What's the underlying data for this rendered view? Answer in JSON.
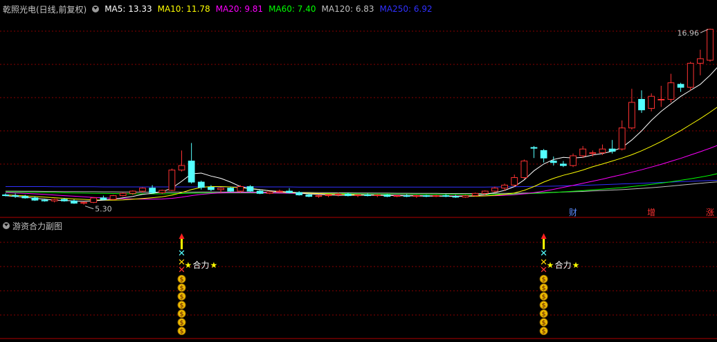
{
  "header": {
    "title": "乾照光电(日线,前复权)",
    "ma": [
      {
        "label": "MA5: 13.33",
        "color": "#ffffff"
      },
      {
        "label": "MA10: 11.78",
        "color": "#ffff00"
      },
      {
        "label": "MA20: 9.81",
        "color": "#ff00ff"
      },
      {
        "label": "MA60: 7.40",
        "color": "#00ff00"
      },
      {
        "label": "MA120: 6.83",
        "color": "#c0c0c0"
      },
      {
        "label": "MA250: 6.92",
        "color": "#3030ff"
      }
    ]
  },
  "sub_panel": {
    "title": "游资合力副图",
    "signal_text": "合力"
  },
  "colors": {
    "up": "#ff3232",
    "down": "#54ffff",
    "ma5": "#ffffff",
    "ma10": "#ffff00",
    "ma20": "#ff00ff",
    "ma60": "#00ff00",
    "ma120": "#c0c0c0",
    "ma250": "#3030ff",
    "grid": "#8b0000"
  },
  "chart_data": {
    "type": "candlestick",
    "ylim": [
      4.5,
      17.8
    ],
    "annotations": {
      "high_label": "16.96",
      "low_label": "5.30"
    },
    "candles": [
      {
        "o": 5.95,
        "h": 6.05,
        "l": 5.85,
        "c": 5.9
      },
      {
        "o": 5.9,
        "h": 6.05,
        "l": 5.75,
        "c": 5.85
      },
      {
        "o": 5.85,
        "h": 5.95,
        "l": 5.7,
        "c": 5.75
      },
      {
        "o": 5.75,
        "h": 5.85,
        "l": 5.55,
        "c": 5.6
      },
      {
        "o": 5.6,
        "h": 5.7,
        "l": 5.5,
        "c": 5.55
      },
      {
        "o": 5.55,
        "h": 5.7,
        "l": 5.45,
        "c": 5.65
      },
      {
        "o": 5.65,
        "h": 5.75,
        "l": 5.5,
        "c": 5.55
      },
      {
        "o": 5.55,
        "h": 5.65,
        "l": 5.35,
        "c": 5.4
      },
      {
        "o": 5.4,
        "h": 5.5,
        "l": 5.3,
        "c": 5.45
      },
      {
        "o": 5.45,
        "h": 5.8,
        "l": 5.4,
        "c": 5.75
      },
      {
        "o": 5.75,
        "h": 5.9,
        "l": 5.6,
        "c": 5.65
      },
      {
        "o": 5.65,
        "h": 5.95,
        "l": 5.6,
        "c": 5.9
      },
      {
        "o": 5.9,
        "h": 6.1,
        "l": 5.85,
        "c": 6.05
      },
      {
        "o": 6.05,
        "h": 6.25,
        "l": 5.95,
        "c": 6.2
      },
      {
        "o": 6.2,
        "h": 6.45,
        "l": 6.1,
        "c": 6.4
      },
      {
        "o": 6.4,
        "h": 6.6,
        "l": 6.05,
        "c": 6.1
      },
      {
        "o": 6.1,
        "h": 6.3,
        "l": 6.0,
        "c": 6.25
      },
      {
        "o": 6.25,
        "h": 7.7,
        "l": 6.2,
        "c": 7.6
      },
      {
        "o": 7.6,
        "h": 8.9,
        "l": 7.5,
        "c": 7.9
      },
      {
        "o": 8.2,
        "h": 9.4,
        "l": 6.7,
        "c": 6.8
      },
      {
        "o": 6.8,
        "h": 6.9,
        "l": 6.3,
        "c": 6.45
      },
      {
        "o": 6.45,
        "h": 6.6,
        "l": 6.2,
        "c": 6.3
      },
      {
        "o": 6.3,
        "h": 6.45,
        "l": 6.1,
        "c": 6.4
      },
      {
        "o": 6.4,
        "h": 6.5,
        "l": 6.15,
        "c": 6.2
      },
      {
        "o": 6.2,
        "h": 6.6,
        "l": 6.1,
        "c": 6.5
      },
      {
        "o": 6.5,
        "h": 6.6,
        "l": 6.15,
        "c": 6.2
      },
      {
        "o": 6.2,
        "h": 6.3,
        "l": 6.0,
        "c": 6.05
      },
      {
        "o": 6.05,
        "h": 6.2,
        "l": 6.0,
        "c": 6.15
      },
      {
        "o": 6.15,
        "h": 6.3,
        "l": 6.1,
        "c": 6.2
      },
      {
        "o": 6.2,
        "h": 6.4,
        "l": 6.05,
        "c": 6.1
      },
      {
        "o": 6.1,
        "h": 6.2,
        "l": 5.9,
        "c": 5.95
      },
      {
        "o": 5.95,
        "h": 6.05,
        "l": 5.8,
        "c": 5.85
      },
      {
        "o": 5.85,
        "h": 5.95,
        "l": 5.75,
        "c": 5.9
      },
      {
        "o": 5.9,
        "h": 6.0,
        "l": 5.8,
        "c": 5.95
      },
      {
        "o": 5.95,
        "h": 6.1,
        "l": 5.85,
        "c": 6.0
      },
      {
        "o": 6.0,
        "h": 6.1,
        "l": 5.85,
        "c": 5.9
      },
      {
        "o": 5.9,
        "h": 6.0,
        "l": 5.8,
        "c": 5.95
      },
      {
        "o": 5.95,
        "h": 6.05,
        "l": 5.85,
        "c": 5.9
      },
      {
        "o": 5.9,
        "h": 6.0,
        "l": 5.8,
        "c": 5.95
      },
      {
        "o": 5.95,
        "h": 6.0,
        "l": 5.8,
        "c": 5.85
      },
      {
        "o": 5.85,
        "h": 5.95,
        "l": 5.8,
        "c": 5.9
      },
      {
        "o": 5.9,
        "h": 6.0,
        "l": 5.8,
        "c": 5.85
      },
      {
        "o": 5.85,
        "h": 5.95,
        "l": 5.75,
        "c": 5.9
      },
      {
        "o": 5.9,
        "h": 5.95,
        "l": 5.8,
        "c": 5.85
      },
      {
        "o": 5.85,
        "h": 5.95,
        "l": 5.8,
        "c": 5.9
      },
      {
        "o": 5.9,
        "h": 6.0,
        "l": 5.8,
        "c": 5.85
      },
      {
        "o": 5.85,
        "h": 5.95,
        "l": 5.75,
        "c": 5.8
      },
      {
        "o": 5.8,
        "h": 5.95,
        "l": 5.75,
        "c": 5.9
      },
      {
        "o": 5.9,
        "h": 6.1,
        "l": 5.85,
        "c": 6.05
      },
      {
        "o": 6.05,
        "h": 6.25,
        "l": 5.95,
        "c": 6.2
      },
      {
        "o": 6.2,
        "h": 6.5,
        "l": 6.1,
        "c": 6.4
      },
      {
        "o": 6.4,
        "h": 6.7,
        "l": 6.2,
        "c": 6.6
      },
      {
        "o": 6.6,
        "h": 7.3,
        "l": 6.5,
        "c": 7.1
      },
      {
        "o": 7.1,
        "h": 8.3,
        "l": 7.0,
        "c": 8.2
      },
      {
        "o": 9.1,
        "h": 9.2,
        "l": 8.4,
        "c": 9.05
      },
      {
        "o": 8.9,
        "h": 9.0,
        "l": 8.1,
        "c": 8.4
      },
      {
        "o": 8.2,
        "h": 8.5,
        "l": 7.9,
        "c": 8.1
      },
      {
        "o": 8.0,
        "h": 8.2,
        "l": 7.8,
        "c": 7.9
      },
      {
        "o": 7.9,
        "h": 8.7,
        "l": 7.8,
        "c": 8.55
      },
      {
        "o": 8.55,
        "h": 9.2,
        "l": 8.4,
        "c": 9.0
      },
      {
        "o": 8.7,
        "h": 8.9,
        "l": 8.5,
        "c": 8.75
      },
      {
        "o": 8.75,
        "h": 9.3,
        "l": 8.6,
        "c": 9.0
      },
      {
        "o": 9.0,
        "h": 9.6,
        "l": 8.7,
        "c": 8.85
      },
      {
        "o": 9.0,
        "h": 10.9,
        "l": 8.9,
        "c": 10.4
      },
      {
        "o": 10.4,
        "h": 13.0,
        "l": 10.3,
        "c": 12.1
      },
      {
        "o": 12.3,
        "h": 12.9,
        "l": 11.4,
        "c": 11.6
      },
      {
        "o": 11.7,
        "h": 12.7,
        "l": 11.5,
        "c": 12.5
      },
      {
        "o": 12.3,
        "h": 13.2,
        "l": 11.8,
        "c": 12.3
      },
      {
        "o": 12.3,
        "h": 14.0,
        "l": 12.1,
        "c": 13.4
      },
      {
        "o": 13.3,
        "h": 13.4,
        "l": 12.8,
        "c": 13.1
      },
      {
        "o": 13.1,
        "h": 14.8,
        "l": 12.9,
        "c": 14.7
      },
      {
        "o": 14.7,
        "h": 15.6,
        "l": 13.9,
        "c": 15.0
      },
      {
        "o": 14.9,
        "h": 17.0,
        "l": 14.8,
        "c": 16.96
      }
    ],
    "ma5": [
      5.9,
      5.85,
      5.8,
      5.72,
      5.66,
      5.6,
      5.58,
      5.55,
      5.52,
      5.56,
      5.6,
      5.66,
      5.75,
      5.85,
      5.98,
      6.05,
      6.15,
      6.4,
      6.85,
      7.35,
      7.4,
      7.2,
      7.05,
      6.8,
      6.5,
      6.35,
      6.3,
      6.22,
      6.18,
      6.14,
      6.08,
      6.02,
      5.98,
      5.95,
      5.92,
      5.92,
      5.93,
      5.94,
      5.93,
      5.92,
      5.9,
      5.89,
      5.88,
      5.87,
      5.87,
      5.86,
      5.85,
      5.86,
      5.9,
      5.98,
      6.1,
      6.25,
      6.5,
      6.95,
      7.55,
      8.0,
      8.3,
      8.45,
      8.4,
      8.45,
      8.6,
      8.7,
      8.85,
      9.1,
      9.6,
      10.2,
      10.9,
      11.5,
      12.0,
      12.5,
      12.9,
      13.3,
      13.9,
      14.6
    ],
    "ma10": [
      5.95,
      5.92,
      5.88,
      5.84,
      5.8,
      5.76,
      5.72,
      5.68,
      5.65,
      5.62,
      5.6,
      5.6,
      5.62,
      5.66,
      5.71,
      5.76,
      5.82,
      5.93,
      6.1,
      6.3,
      6.45,
      6.5,
      6.5,
      6.48,
      6.42,
      6.38,
      6.3,
      6.22,
      6.15,
      6.1,
      6.08,
      6.06,
      6.04,
      6.02,
      6.0,
      5.98,
      5.96,
      5.94,
      5.92,
      5.91,
      5.9,
      5.9,
      5.89,
      5.88,
      5.88,
      5.87,
      5.86,
      5.86,
      5.86,
      5.88,
      5.92,
      5.98,
      6.08,
      6.25,
      6.5,
      6.8,
      7.05,
      7.25,
      7.42,
      7.6,
      7.82,
      8.0,
      8.2,
      8.4,
      8.62,
      8.88,
      9.18,
      9.5,
      9.85,
      10.22,
      10.62,
      11.02,
      11.45,
      11.9
    ],
    "ma20": [
      6.1,
      6.08,
      6.05,
      6.02,
      5.98,
      5.94,
      5.9,
      5.86,
      5.82,
      5.78,
      5.75,
      5.72,
      5.7,
      5.68,
      5.67,
      5.67,
      5.68,
      5.72,
      5.8,
      5.9,
      5.98,
      6.04,
      6.08,
      6.1,
      6.1,
      6.1,
      6.1,
      6.08,
      6.07,
      6.06,
      6.05,
      6.04,
      6.03,
      6.01,
      6.0,
      5.99,
      5.97,
      5.96,
      5.95,
      5.94,
      5.93,
      5.92,
      5.91,
      5.9,
      5.89,
      5.88,
      5.88,
      5.88,
      5.88,
      5.89,
      5.9,
      5.92,
      5.96,
      6.02,
      6.1,
      6.2,
      6.32,
      6.45,
      6.58,
      6.72,
      6.86,
      7.0,
      7.15,
      7.3,
      7.46,
      7.62,
      7.8,
      7.98,
      8.18,
      8.38,
      8.6,
      8.82,
      9.05,
      9.3
    ],
    "ma60": [
      6.15,
      6.14,
      6.13,
      6.12,
      6.11,
      6.1,
      6.09,
      6.08,
      6.07,
      6.06,
      6.05,
      6.04,
      6.03,
      6.02,
      6.02,
      6.02,
      6.02,
      6.03,
      6.04,
      6.06,
      6.07,
      6.08,
      6.08,
      6.08,
      6.08,
      6.08,
      6.07,
      6.07,
      6.06,
      6.06,
      6.05,
      6.05,
      6.04,
      6.04,
      6.03,
      6.03,
      6.02,
      6.02,
      6.01,
      6.01,
      6.0,
      6.0,
      5.99,
      5.99,
      5.98,
      5.98,
      5.98,
      5.97,
      5.97,
      5.97,
      5.98,
      5.99,
      6.0,
      6.02,
      6.05,
      6.08,
      6.11,
      6.15,
      6.19,
      6.23,
      6.28,
      6.33,
      6.38,
      6.43,
      6.5,
      6.57,
      6.65,
      6.73,
      6.82,
      6.92,
      7.02,
      7.13,
      7.25,
      7.4
    ],
    "ma120": [
      6.2,
      6.2,
      6.19,
      6.19,
      6.18,
      6.18,
      6.17,
      6.17,
      6.16,
      6.16,
      6.15,
      6.15,
      6.14,
      6.14,
      6.13,
      6.13,
      6.13,
      6.13,
      6.13,
      6.13,
      6.14,
      6.14,
      6.14,
      6.14,
      6.14,
      6.13,
      6.13,
      6.13,
      6.12,
      6.12,
      6.11,
      6.11,
      6.1,
      6.1,
      6.09,
      6.09,
      6.08,
      6.08,
      6.07,
      6.07,
      6.06,
      6.06,
      6.05,
      6.05,
      6.05,
      6.04,
      6.04,
      6.04,
      6.04,
      6.04,
      6.05,
      6.05,
      6.06,
      6.07,
      6.08,
      6.1,
      6.12,
      6.14,
      6.16,
      6.18,
      6.21,
      6.24,
      6.27,
      6.3,
      6.34,
      6.38,
      6.43,
      6.48,
      6.54,
      6.6,
      6.66,
      6.72,
      6.78,
      6.83
    ],
    "ma250": [
      6.5,
      6.5,
      6.5,
      6.5,
      6.5,
      6.49,
      6.49,
      6.49,
      6.49,
      6.49,
      6.48,
      6.48,
      6.48,
      6.48,
      6.48,
      6.48,
      6.48,
      6.48,
      6.48,
      6.48,
      6.48,
      6.48,
      6.48,
      6.48,
      6.48,
      6.48,
      6.48,
      6.48,
      6.48,
      6.48,
      6.47,
      6.47,
      6.47,
      6.47,
      6.47,
      6.47,
      6.47,
      6.47,
      6.47,
      6.47,
      6.47,
      6.47,
      6.47,
      6.47,
      6.47,
      6.47,
      6.47,
      6.47,
      6.47,
      6.47,
      6.48,
      6.48,
      6.49,
      6.5,
      6.51,
      6.52,
      6.53,
      6.55,
      6.57,
      6.59,
      6.61,
      6.63,
      6.65,
      6.68,
      6.7,
      6.72,
      6.75,
      6.78,
      6.8,
      6.83,
      6.85,
      6.88,
      6.9,
      6.92
    ],
    "markers": [
      {
        "label": "财",
        "candle": 58,
        "color": "#5a8cff"
      },
      {
        "label": "增",
        "candle": 66,
        "color": "#ff3232"
      },
      {
        "label": "涨",
        "candle": 73,
        "color": "#ff3232"
      }
    ],
    "signals": [
      {
        "candle": 18
      },
      {
        "candle": 55
      }
    ]
  }
}
